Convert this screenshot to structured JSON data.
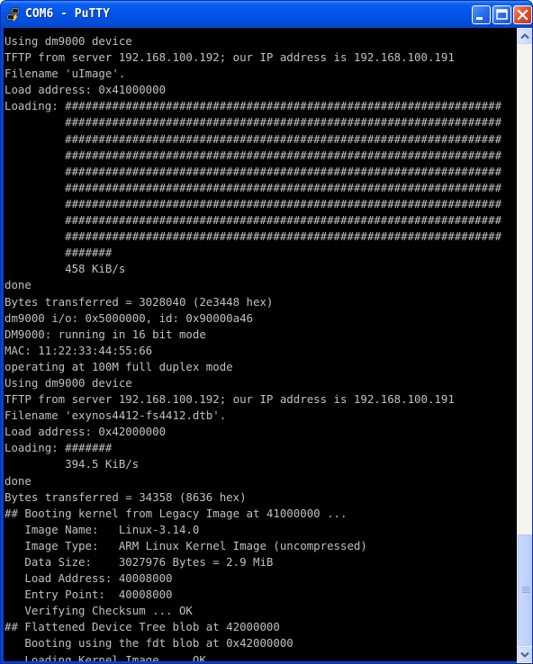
{
  "window": {
    "title": "COM6 - PuTTY"
  },
  "icons": {
    "app": "putty-icon",
    "minimize": "minimize-icon",
    "maximize": "maximize-icon",
    "close": "close-icon",
    "scroll_up": "chevron-up-icon",
    "scroll_down": "chevron-down-icon"
  },
  "colors": {
    "terminal_bg": "#000000",
    "terminal_fg": "#c0c0c0",
    "titlebar": "#0355e8",
    "close_button": "#e0502a"
  },
  "scrollbar": {
    "position_fraction": 1.0
  },
  "terminal": {
    "lines": [
      "Using dm9000 device",
      "TFTP from server 192.168.100.192; our IP address is 192.168.100.191",
      "Filename 'uImage'.",
      "Load address: 0x41000000",
      "Loading: #################################################################",
      "         #################################################################",
      "         #################################################################",
      "         #################################################################",
      "         #################################################################",
      "         #################################################################",
      "         #################################################################",
      "         #################################################################",
      "         #################################################################",
      "         #######",
      "         458 KiB/s",
      "done",
      "Bytes transferred = 3028040 (2e3448 hex)",
      "dm9000 i/o: 0x5000000, id: 0x90000a46",
      "DM9000: running in 16 bit mode",
      "MAC: 11:22:33:44:55:66",
      "operating at 100M full duplex mode",
      "Using dm9000 device",
      "TFTP from server 192.168.100.192; our IP address is 192.168.100.191",
      "Filename 'exynos4412-fs4412.dtb'.",
      "Load address: 0x42000000",
      "Loading: #######",
      "         394.5 KiB/s",
      "done",
      "Bytes transferred = 34358 (8636 hex)",
      "## Booting kernel from Legacy Image at 41000000 ...",
      "   Image Name:   Linux-3.14.0",
      "   Image Type:   ARM Linux Kernel Image (uncompressed)",
      "   Data Size:    3027976 Bytes = 2.9 MiB",
      "   Load Address: 40008000",
      "   Entry Point:  40008000",
      "   Verifying Checksum ... OK",
      "## Flattened Device Tree blob at 42000000",
      "   Booting using the fdt blob at 0x42000000",
      "   Loading Kernel Image ... OK"
    ]
  }
}
